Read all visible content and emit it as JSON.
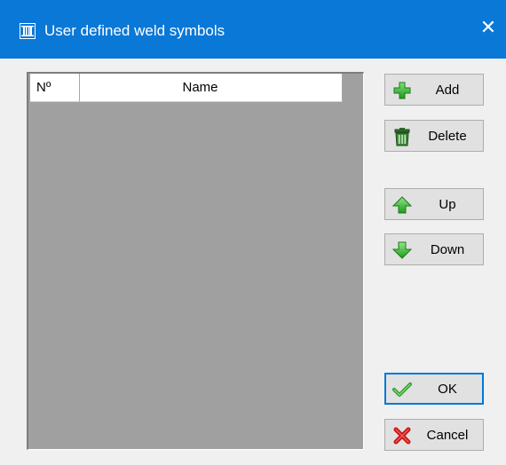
{
  "window": {
    "title": "User defined weld symbols",
    "close_glyph": "✕",
    "title_icon": "dialog-app-icon"
  },
  "list": {
    "columns": [
      "Nº",
      "Name"
    ],
    "rows": []
  },
  "buttons": {
    "add": "Add",
    "delete": "Delete",
    "up": "Up",
    "down": "Down",
    "ok": "OK",
    "cancel": "Cancel"
  },
  "icons": {
    "add": "green-plus-icon",
    "delete": "trash-can-icon",
    "up": "green-up-arrow-icon",
    "down": "green-down-arrow-icon",
    "ok": "green-check-icon",
    "cancel": "red-x-icon"
  },
  "colors": {
    "titlebar": "#0a78d7",
    "dialog_bg": "#f0f0f0",
    "list_bg": "#a0a0a0",
    "button_bg": "#e1e1e1",
    "focus_border": "#0078d7"
  }
}
